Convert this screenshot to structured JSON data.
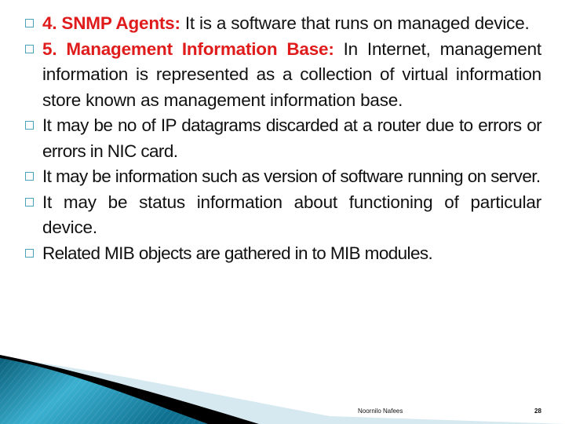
{
  "slide": {
    "items": [
      {
        "label": "4. SNMP Agents:",
        "text": " It is a software that runs on managed device."
      },
      {
        "label": "5. Management Information Base:",
        "text": " In Internet, management information is represented as a collection of virtual information store known as management information base."
      },
      {
        "label": "",
        "text": "It may be no of IP datagrams discarded at a router due to errors or errors in NIC card."
      },
      {
        "label": "",
        "text": "It may be information such as version of software running on server."
      },
      {
        "label": "",
        "text": "It may be status information about functioning of particular device."
      },
      {
        "label": "",
        "text": "Related MIB objects are gathered in to MIB modules."
      }
    ],
    "footer": {
      "author": "Noornilo Nafees",
      "page_number": "28"
    },
    "colors": {
      "accent_red": "#e01b1b",
      "bullet_teal": "#4aa3b8",
      "wave_blue": "#1a8aa8"
    }
  }
}
